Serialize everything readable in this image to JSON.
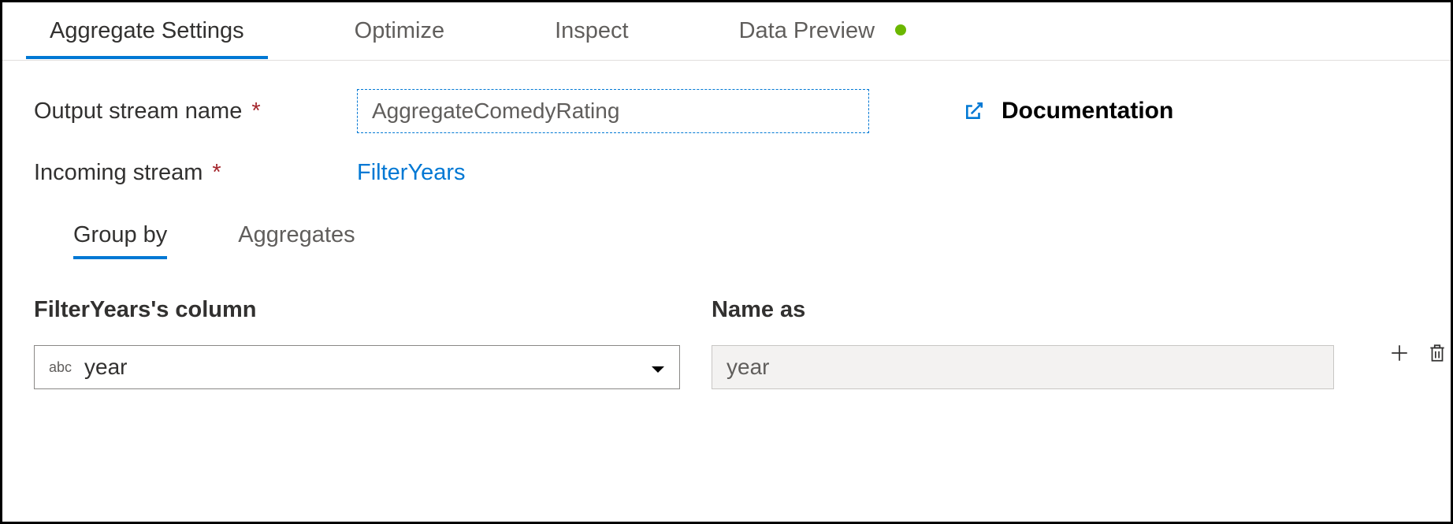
{
  "tabs": {
    "aggregate_settings": "Aggregate Settings",
    "optimize": "Optimize",
    "inspect": "Inspect",
    "data_preview": "Data Preview"
  },
  "form": {
    "output_stream_label": "Output stream name",
    "output_stream_value": "AggregateComedyRating",
    "incoming_stream_label": "Incoming stream",
    "incoming_stream_value": "FilterYears"
  },
  "doc_link_label": "Documentation",
  "subtabs": {
    "group_by": "Group by",
    "aggregates": "Aggregates"
  },
  "group_by": {
    "column_header": "FilterYears's column",
    "name_as_header": "Name as",
    "rows": [
      {
        "type_badge": "abc",
        "column": "year",
        "name_as": "year"
      }
    ]
  }
}
